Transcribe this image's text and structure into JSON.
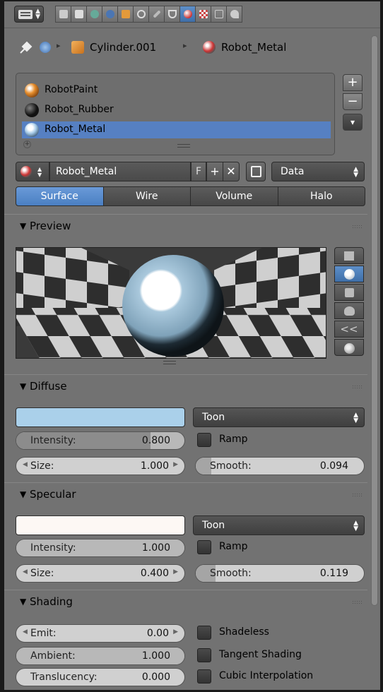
{
  "breadcrumb": {
    "object_label": "Cylinder.001",
    "material_label": "Robot_Metal"
  },
  "material_slots": [
    {
      "name": "RobotPaint",
      "ball_color": "#d06c1a",
      "selected": false
    },
    {
      "name": "Robot_Rubber",
      "ball_color": "#1a1a1a",
      "selected": false
    },
    {
      "name": "Robot_Metal",
      "ball_color": "#b8d8f0",
      "selected": true
    }
  ],
  "slot_buttons": {
    "add": "+",
    "remove": "−",
    "menu": "▾"
  },
  "material_row": {
    "name": "Robot_Metal",
    "fake_user": "F",
    "add": "+",
    "unlink": "✕",
    "link_type": "Data"
  },
  "type_tabs": [
    "Surface",
    "Wire",
    "Volume",
    "Halo"
  ],
  "type_tab_active": "Surface",
  "panels": {
    "preview": "Preview",
    "diffuse": "Diffuse",
    "specular": "Specular",
    "shading": "Shading"
  },
  "diffuse": {
    "color": "#aad0ea",
    "shader": "Toon",
    "intensity_label": "Intensity:",
    "intensity": "0.800",
    "ramp_label": "Ramp",
    "size_label": "Size:",
    "size": "1.000",
    "smooth_label": "Smooth:",
    "smooth": "0.094"
  },
  "specular": {
    "color": "#fdf8f4",
    "shader": "Toon",
    "intensity_label": "Intensity:",
    "intensity": "1.000",
    "ramp_label": "Ramp",
    "size_label": "Size:",
    "size": "0.400",
    "smooth_label": "Smooth:",
    "smooth": "0.119"
  },
  "shading": {
    "emit_label": "Emit:",
    "emit": "0.00",
    "shadeless_label": "Shadeless",
    "ambient_label": "Ambient:",
    "ambient": "1.000",
    "tangent_label": "Tangent Shading",
    "translucency_label": "Translucency:",
    "translucency": "0.000",
    "cubic_label": "Cubic Interpolation"
  },
  "fills": {
    "diffuse_intensity": 0.8,
    "diffuse_smooth": 0.094,
    "specular_intensity": 1.0,
    "specular_smooth": 0.119,
    "ambient": 1.0,
    "translucency": 0.0
  },
  "colors": {
    "accent": "#5680c2",
    "panel_bg": "#727272"
  }
}
